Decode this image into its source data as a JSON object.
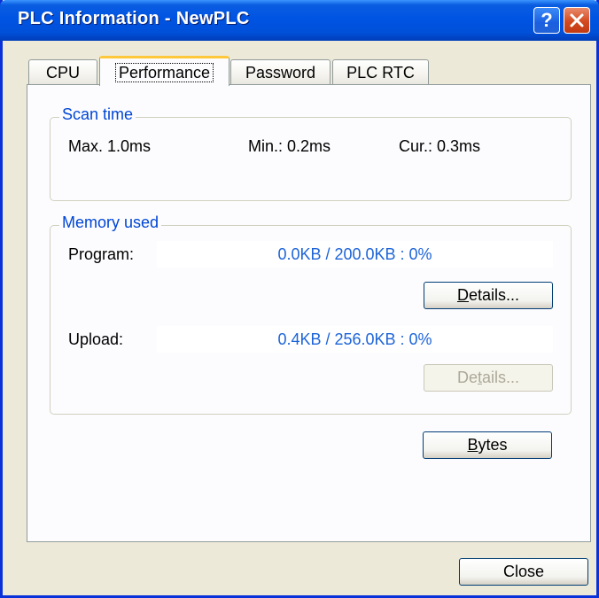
{
  "window": {
    "title": "PLC Information - NewPLC"
  },
  "title_buttons": {
    "help": "?",
    "close": "✕"
  },
  "tabs": [
    {
      "label": "CPU"
    },
    {
      "label": "Performance",
      "active": true
    },
    {
      "label": "Password"
    },
    {
      "label": "PLC RTC"
    }
  ],
  "scan_time": {
    "legend": "Scan time",
    "max": "Max. 1.0ms",
    "min": "Min.: 0.2ms",
    "cur": "Cur.: 0.3ms"
  },
  "memory": {
    "legend": "Memory used",
    "program_label": "Program:",
    "program_value": "0.0KB / 200.0KB : 0%",
    "program_details": {
      "pre": "",
      "mnemonic": "D",
      "post": "etails...",
      "enabled": true
    },
    "upload_label": "Upload:",
    "upload_value": "0.4KB / 256.0KB : 0%",
    "upload_details": {
      "pre": "De",
      "mnemonic": "t",
      "post": "ails...",
      "enabled": false
    }
  },
  "bytes_button": {
    "mnemonic": "B",
    "rest": "ytes"
  },
  "close_button": "Close",
  "colors": {
    "accent": "#0046D5",
    "value_text": "#1D64D8",
    "titlebar": "#0054E3"
  }
}
